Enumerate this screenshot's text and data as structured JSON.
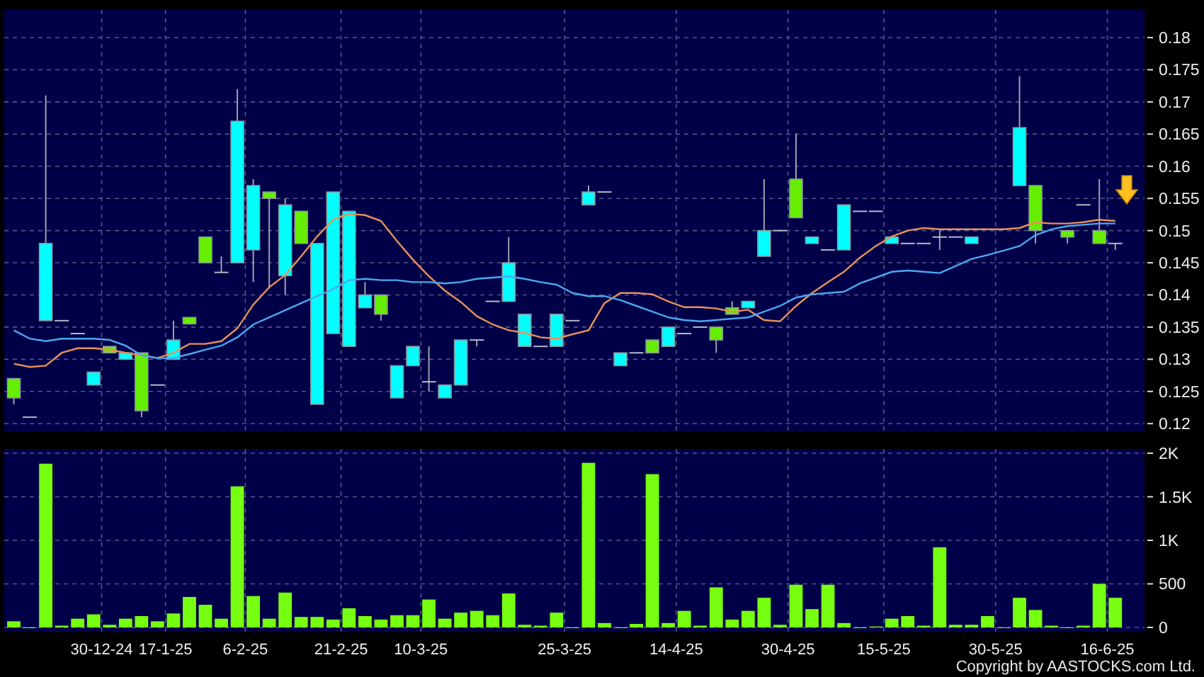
{
  "price_chart": {
    "chart_data": {
      "type": "candlestick",
      "grid": true,
      "categories": [
        null,
        null,
        null,
        null,
        null,
        null,
        null,
        null,
        null,
        null,
        null,
        null,
        null,
        null,
        null,
        null,
        null,
        null,
        null,
        null,
        null,
        null,
        null,
        null,
        null,
        null,
        null,
        null,
        null,
        null,
        null,
        null,
        null,
        null,
        null,
        null,
        null,
        null,
        null,
        null,
        null,
        null,
        null,
        null,
        null,
        null,
        null,
        null,
        null,
        null,
        null,
        null,
        null,
        null,
        null,
        null,
        null,
        null,
        null,
        null,
        null,
        null,
        null,
        null,
        null,
        null,
        null,
        null,
        null,
        null
      ],
      "ylim": [
        0.1187,
        0.1843
      ],
      "yticks": [
        {
          "value": 0.12,
          "label": "0.12"
        },
        {
          "value": 0.125,
          "label": "0.125"
        },
        {
          "value": 0.13,
          "label": "0.13"
        },
        {
          "value": 0.135,
          "label": "0.135"
        },
        {
          "value": 0.14,
          "label": "0.14"
        },
        {
          "value": 0.145,
          "label": "0.145"
        },
        {
          "value": 0.15,
          "label": "0.15"
        },
        {
          "value": 0.155,
          "label": "0.155"
        },
        {
          "value": 0.16,
          "label": "0.16"
        },
        {
          "value": 0.165,
          "label": "0.165"
        },
        {
          "value": 0.17,
          "label": "0.17"
        },
        {
          "value": 0.175,
          "label": "0.175"
        },
        {
          "value": 0.18,
          "label": "0.18"
        }
      ],
      "ohlc": [
        [
          0.127,
          0.127,
          0.123,
          0.124
        ],
        [
          0.121,
          0.121,
          0.121,
          0.121
        ],
        [
          0.136,
          0.171,
          0.136,
          0.148
        ],
        [
          0.136,
          0.136,
          0.136,
          0.136
        ],
        [
          0.134,
          0.134,
          0.134,
          0.134
        ],
        [
          0.126,
          0.128,
          0.126,
          0.128
        ],
        [
          0.132,
          0.132,
          0.131,
          0.131
        ],
        [
          0.13,
          0.131,
          0.13,
          0.131
        ],
        [
          0.131,
          0.131,
          0.121,
          0.122
        ],
        [
          0.126,
          0.126,
          0.126,
          0.126
        ],
        [
          0.13,
          0.136,
          0.13,
          0.133
        ],
        [
          0.1365,
          0.1365,
          0.1355,
          0.1355
        ],
        [
          0.149,
          0.149,
          0.145,
          0.145
        ],
        [
          0.1435,
          0.146,
          0.1435,
          0.1435
        ],
        [
          0.145,
          0.172,
          0.145,
          0.167
        ],
        [
          0.147,
          0.158,
          0.142,
          0.157
        ],
        [
          0.156,
          0.156,
          0.141,
          0.155
        ],
        [
          0.143,
          0.155,
          0.14,
          0.154
        ],
        [
          0.153,
          0.153,
          0.148,
          0.148
        ],
        [
          0.123,
          0.148,
          0.123,
          0.148
        ],
        [
          0.134,
          0.156,
          0.134,
          0.156
        ],
        [
          0.132,
          0.153,
          0.132,
          0.153
        ],
        [
          0.138,
          0.142,
          0.138,
          0.14
        ],
        [
          0.14,
          0.14,
          0.136,
          0.137
        ],
        [
          0.124,
          0.129,
          0.124,
          0.129
        ],
        [
          0.129,
          0.132,
          0.129,
          0.132
        ],
        [
          0.1265,
          0.132,
          0.125,
          0.1265
        ],
        [
          0.124,
          0.126,
          0.124,
          0.126
        ],
        [
          0.126,
          0.133,
          0.126,
          0.133
        ],
        [
          0.133,
          0.133,
          0.132,
          0.133
        ],
        [
          0.139,
          0.139,
          0.139,
          0.139
        ],
        [
          0.139,
          0.149,
          0.139,
          0.145
        ],
        [
          0.132,
          0.137,
          0.132,
          0.137
        ],
        [
          0.132,
          0.132,
          0.132,
          0.132
        ],
        [
          0.132,
          0.137,
          0.132,
          0.137
        ],
        [
          0.136,
          0.136,
          0.136,
          0.136
        ],
        [
          0.154,
          0.157,
          0.154,
          0.156
        ],
        [
          0.156,
          0.156,
          0.156,
          0.156
        ],
        [
          0.129,
          0.131,
          0.129,
          0.131
        ],
        [
          0.131,
          0.131,
          0.131,
          0.131
        ],
        [
          0.133,
          0.133,
          0.131,
          0.131
        ],
        [
          0.132,
          0.135,
          0.132,
          0.135
        ],
        [
          0.134,
          0.134,
          0.134,
          0.134
        ],
        [
          0.135,
          0.135,
          0.135,
          0.135
        ],
        [
          0.135,
          0.135,
          0.131,
          0.133
        ],
        [
          0.138,
          0.139,
          0.137,
          0.137
        ],
        [
          0.138,
          0.139,
          0.138,
          0.139
        ],
        [
          0.146,
          0.158,
          0.146,
          0.15
        ],
        [
          0.15,
          0.15,
          0.15,
          0.15
        ],
        [
          0.158,
          0.165,
          0.152,
          0.152
        ],
        [
          0.148,
          0.149,
          0.148,
          0.149
        ],
        [
          0.147,
          0.147,
          0.147,
          0.147
        ],
        [
          0.147,
          0.154,
          0.147,
          0.154
        ],
        [
          0.153,
          0.153,
          0.153,
          0.153
        ],
        [
          0.153,
          0.153,
          0.153,
          0.153
        ],
        [
          0.148,
          0.149,
          0.148,
          0.149
        ],
        [
          0.148,
          0.148,
          0.148,
          0.148
        ],
        [
          0.148,
          0.148,
          0.148,
          0.148
        ],
        [
          0.149,
          0.15,
          0.147,
          0.149
        ],
        [
          0.149,
          0.149,
          0.149,
          0.149
        ],
        [
          0.148,
          0.149,
          0.148,
          0.149
        ],
        null,
        null,
        [
          0.157,
          0.174,
          0.157,
          0.166
        ],
        [
          0.157,
          0.157,
          0.148,
          0.15
        ],
        null,
        [
          0.15,
          0.15,
          0.148,
          0.149
        ],
        [
          0.154,
          0.154,
          0.154,
          0.154
        ],
        [
          0.15,
          0.158,
          0.148,
          0.148
        ],
        [
          0.148,
          0.148,
          0.147,
          0.148
        ]
      ],
      "series": [
        {
          "type": "line",
          "color": "#e8915a",
          "values": [
            0.1293,
            0.1288,
            0.129,
            0.131,
            0.1317,
            0.1317,
            0.1315,
            0.131,
            0.1306,
            0.1302,
            0.131,
            0.1324,
            0.1324,
            0.1328,
            0.1348,
            0.1385,
            0.1412,
            0.1431,
            0.146,
            0.1491,
            0.1517,
            0.1526,
            0.1524,
            0.1515,
            0.1484,
            0.1455,
            0.1429,
            0.1407,
            0.1389,
            0.1367,
            0.1354,
            0.1345,
            0.1341,
            0.1334,
            0.1332,
            0.1339,
            0.1345,
            0.1387,
            0.1403,
            0.1403,
            0.1401,
            0.139,
            0.1381,
            0.1381,
            0.1379,
            0.1374,
            0.1377,
            0.1361,
            0.1359,
            0.1383,
            0.1403,
            0.142,
            0.1436,
            0.1458,
            0.1476,
            0.1491,
            0.15,
            0.1504,
            0.1502,
            0.1502,
            0.1502,
            0.1502,
            0.1502,
            0.1504,
            0.1513,
            0.1511,
            0.1511,
            0.1513,
            0.1517,
            0.1515
          ]
        },
        {
          "type": "line",
          "color": "#4aa8f0",
          "values": [
            0.1345,
            0.1332,
            0.1328,
            0.1332,
            0.1332,
            0.1332,
            0.133,
            0.1321,
            0.1306,
            0.1302,
            0.1302,
            0.1308,
            0.1315,
            0.1321,
            0.1334,
            0.1354,
            0.1365,
            0.1376,
            0.1387,
            0.1398,
            0.1409,
            0.1423,
            0.1425,
            0.1423,
            0.1423,
            0.142,
            0.142,
            0.1418,
            0.142,
            0.1425,
            0.1427,
            0.1429,
            0.1425,
            0.142,
            0.1416,
            0.1403,
            0.1398,
            0.1398,
            0.1392,
            0.1383,
            0.1374,
            0.1365,
            0.1361,
            0.1359,
            0.1361,
            0.1363,
            0.1365,
            0.1374,
            0.1383,
            0.1396,
            0.1401,
            0.1403,
            0.1405,
            0.1418,
            0.1427,
            0.1436,
            0.1438,
            0.1436,
            0.1434,
            0.1445,
            0.1456,
            0.1462,
            0.1469,
            0.1476,
            0.1493,
            0.1502,
            0.1507,
            0.1509,
            0.1511,
            0.1511
          ]
        }
      ]
    }
  },
  "volume_chart": {
    "chart_data": {
      "type": "bar",
      "grid": true,
      "categories": [
        null,
        null,
        null,
        null,
        null,
        "30-12-24",
        null,
        null,
        null,
        "17-1-25",
        null,
        null,
        null,
        null,
        "6-2-25",
        null,
        null,
        null,
        null,
        null,
        "21-2-25",
        null,
        null,
        null,
        null,
        "10-3-25",
        null,
        null,
        null,
        null,
        null,
        null,
        null,
        null,
        "25-3-25",
        null,
        null,
        null,
        null,
        null,
        null,
        "14-4-25",
        null,
        null,
        null,
        null,
        null,
        null,
        "30-4-25",
        null,
        null,
        null,
        null,
        null,
        "15-5-25",
        null,
        null,
        null,
        null,
        null,
        null,
        "30-5-25",
        null,
        null,
        null,
        null,
        null,
        null,
        "16-6-25",
        null
      ],
      "ylim": [
        -49,
        2049
      ],
      "yticks": [
        {
          "value": 0,
          "label": "0"
        },
        {
          "value": 500,
          "label": "500"
        },
        {
          "value": 1000,
          "label": "1K"
        },
        {
          "value": 1500,
          "label": "1.5K"
        },
        {
          "value": 2000,
          "label": "2K"
        }
      ],
      "series": [
        {
          "color": "#77ff11",
          "values": [
            70,
            0,
            1880,
            20,
            100,
            150,
            30,
            100,
            130,
            70,
            160,
            350,
            260,
            100,
            1620,
            360,
            100,
            400,
            120,
            120,
            90,
            220,
            130,
            90,
            140,
            140,
            320,
            100,
            170,
            190,
            140,
            390,
            30,
            20,
            170,
            0,
            1890,
            50,
            0,
            40,
            1760,
            50,
            190,
            20,
            460,
            90,
            190,
            340,
            30,
            490,
            210,
            490,
            50,
            0,
            10,
            100,
            130,
            20,
            920,
            30,
            30,
            130,
            0,
            340,
            200,
            20,
            0,
            20,
            500,
            340
          ]
        }
      ]
    }
  },
  "copyright": "Copyright by AASTOCKS.com Ltd."
}
